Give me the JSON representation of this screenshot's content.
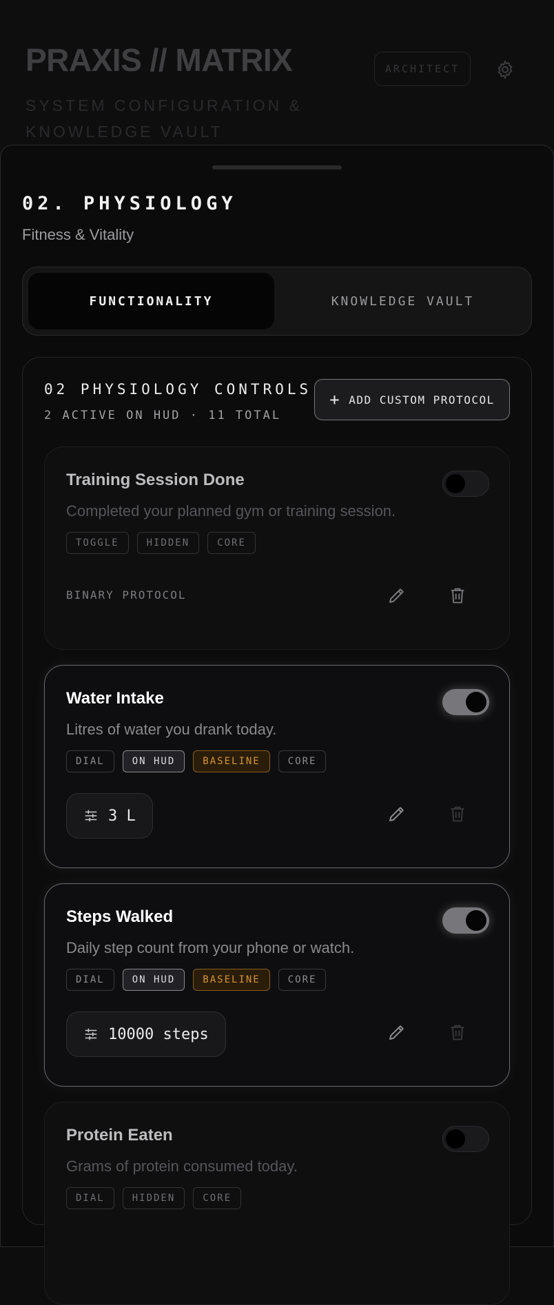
{
  "header": {
    "app_title": "PRAXIS // MATRIX",
    "subtitle": "SYSTEM CONFIGURATION & KNOWLEDGE VAULT",
    "role_badge": "ARCHITECT"
  },
  "section": {
    "title": "02. PHYSIOLOGY",
    "subtitle": "Fitness & Vitality"
  },
  "tabs": [
    {
      "label": "FUNCTIONALITY",
      "active": true
    },
    {
      "label": "KNOWLEDGE VAULT",
      "active": false
    }
  ],
  "controls": {
    "title": "02 PHYSIOLOGY CONTROLS",
    "summary": "2 ACTIVE ON HUD · 11 TOTAL",
    "add_button": "ADD CUSTOM PROTOCOL"
  },
  "cards": [
    {
      "title": "Training Session Done",
      "description": "Completed your planned gym or training session.",
      "tags": [
        "TOGGLE",
        "HIDDEN",
        "CORE"
      ],
      "enabled": false,
      "footer": "BINARY PROTOCOL"
    },
    {
      "title": "Water Intake",
      "description": "Litres of water you drank today.",
      "tags": [
        "DIAL",
        "ON HUD",
        "BASELINE",
        "CORE"
      ],
      "enabled": true,
      "value": "3 L"
    },
    {
      "title": "Steps Walked",
      "description": "Daily step count from your phone or watch.",
      "tags": [
        "DIAL",
        "ON HUD",
        "BASELINE",
        "CORE"
      ],
      "enabled": true,
      "value": "10000 steps"
    },
    {
      "title": "Protein Eaten",
      "description": "Grams of protein consumed today.",
      "tags": [
        "DIAL",
        "HIDDEN",
        "CORE"
      ],
      "enabled": false
    }
  ],
  "colors": {
    "accent_baseline": "#d9952f",
    "background": "#0b0b0c"
  }
}
